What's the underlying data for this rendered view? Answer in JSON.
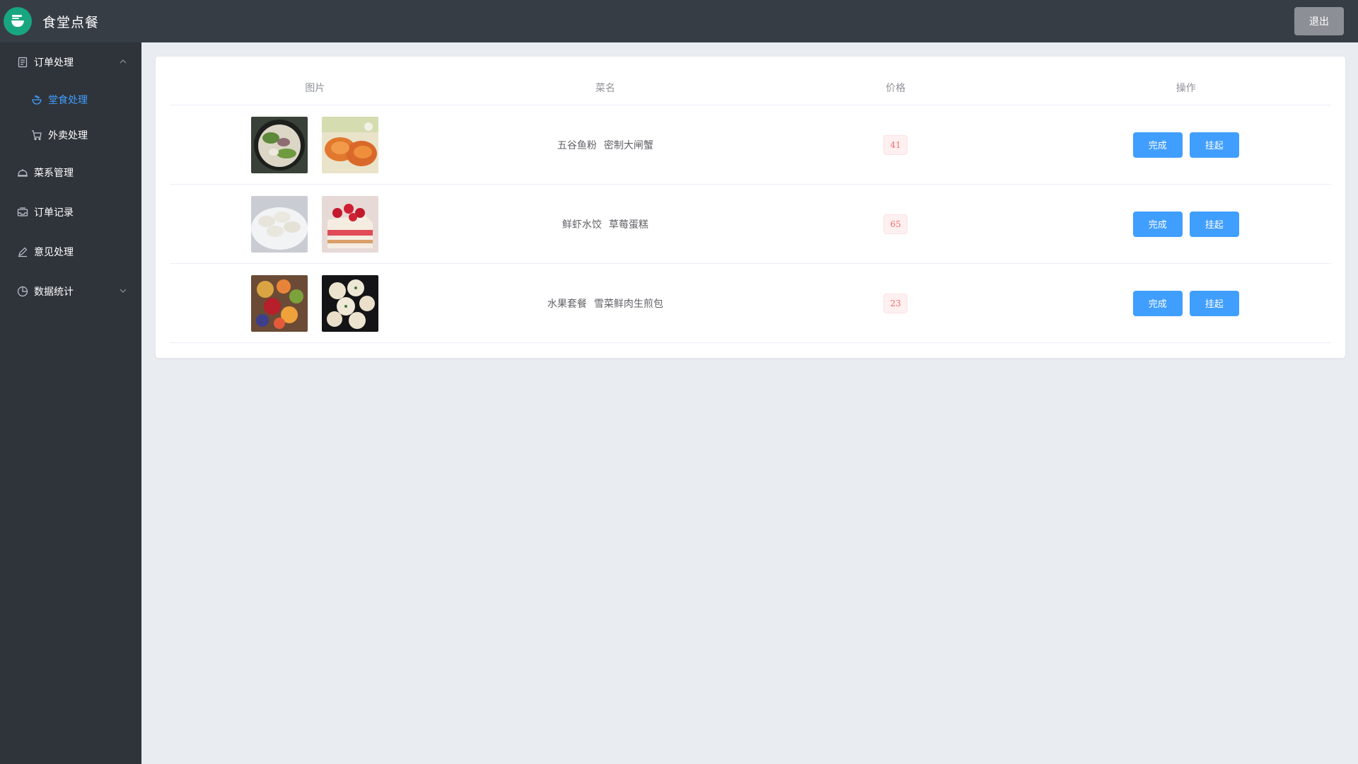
{
  "header": {
    "title": "食堂点餐",
    "logout_label": "退出",
    "logo_icon": "bowl-icon"
  },
  "sidebar": {
    "items": [
      {
        "label": "订单处理",
        "icon": "document-icon",
        "expanded": true,
        "children": [
          {
            "label": "堂食处理",
            "icon": "bowl-icon",
            "active": true
          },
          {
            "label": "外卖处理",
            "icon": "cart-icon",
            "active": false
          }
        ]
      },
      {
        "label": "菜系管理",
        "icon": "dish-cover-icon"
      },
      {
        "label": "订单记录",
        "icon": "inbox-icon"
      },
      {
        "label": "意见处理",
        "icon": "edit-icon"
      },
      {
        "label": "数据统计",
        "icon": "pie-chart-icon",
        "expanded": false
      }
    ]
  },
  "table": {
    "headers": [
      "图片",
      "菜名",
      "价格",
      "操作"
    ],
    "rows": [
      {
        "images": [
          "fish-noodle-photo",
          "crab-photo"
        ],
        "dishes": [
          "五谷鱼粉",
          "密制大闸蟹"
        ],
        "price": "41",
        "actions": [
          "完成",
          "挂起"
        ]
      },
      {
        "images": [
          "dumpling-photo",
          "strawberry-cake-photo"
        ],
        "dishes": [
          "鲜虾水饺",
          "草莓蛋糕"
        ],
        "price": "65",
        "actions": [
          "完成",
          "挂起"
        ]
      },
      {
        "images": [
          "fruit-platter-photo",
          "fried-bun-photo"
        ],
        "dishes": [
          "水果套餐",
          "雪菜鲜肉生煎包"
        ],
        "price": "23",
        "actions": [
          "完成",
          "挂起"
        ]
      }
    ]
  },
  "colors": {
    "header_bg": "#373d45",
    "sidebar_bg": "#2f343b",
    "accent": "#409eff",
    "logo_green": "#17a67f",
    "price_red": "#f56c6c"
  }
}
